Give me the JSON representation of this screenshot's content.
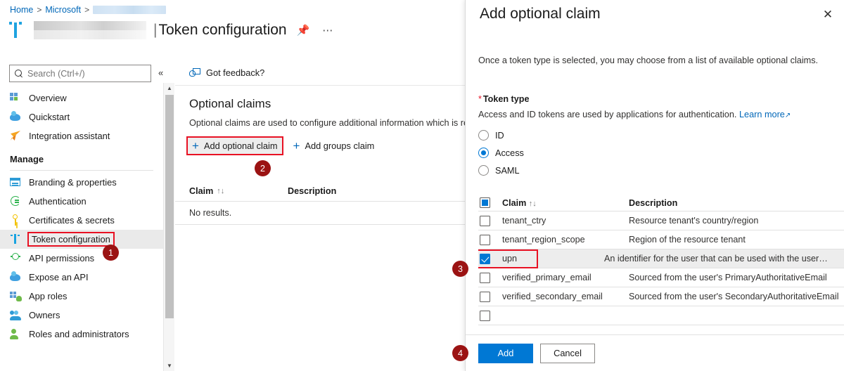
{
  "breadcrumb": {
    "home": "Home",
    "microsoft": "Microsoft",
    "sep": ">",
    "app_redacted": ""
  },
  "header": {
    "title_separator": "|",
    "title": "Token configuration",
    "pin_icon": "pin-icon",
    "more_icon": "ellipsis-icon"
  },
  "sidebar": {
    "search": {
      "placeholder": "Search (Ctrl+/)",
      "value": ""
    },
    "collapse_icon": "«",
    "items": [
      {
        "label": "Overview",
        "icon": "overview-grid-icon"
      },
      {
        "label": "Quickstart",
        "icon": "quickstart-cloud-icon"
      },
      {
        "label": "Integration assistant",
        "icon": "rocket-icon"
      }
    ],
    "section_manage": "Manage",
    "manage_items": [
      {
        "label": "Branding & properties",
        "icon": "branding-card-icon"
      },
      {
        "label": "Authentication",
        "icon": "authentication-icon"
      },
      {
        "label": "Certificates & secrets",
        "icon": "key-icon"
      },
      {
        "label": "Token configuration",
        "icon": "token-bars-icon",
        "selected": true
      },
      {
        "label": "API permissions",
        "icon": "api-permissions-icon"
      },
      {
        "label": "Expose an API",
        "icon": "expose-api-cloud-icon"
      },
      {
        "label": "App roles",
        "icon": "app-roles-icon"
      },
      {
        "label": "Owners",
        "icon": "owners-icon"
      },
      {
        "label": "Roles and administrators",
        "icon": "roles-admins-icon"
      }
    ]
  },
  "main": {
    "feedback": {
      "label": "Got feedback?",
      "icon": "feedback-person-icon"
    },
    "section_title": "Optional claims",
    "section_desc": "Optional claims are used to configure additional information which is re",
    "commands": [
      {
        "label": "Add optional claim",
        "icon": "plus-icon",
        "highlighted": true
      },
      {
        "label": "Add groups claim",
        "icon": "plus-icon",
        "highlighted": false
      }
    ],
    "table": {
      "columns": [
        "Claim",
        "Description"
      ],
      "sort_icon": "↑↓",
      "empty_text": "No results."
    }
  },
  "panel": {
    "title": "Add optional claim",
    "close_icon": "close-icon",
    "intro": "Once a token type is selected, you may choose from a list of available optional claims.",
    "token_type": {
      "label": "Token type",
      "required_marker": "*",
      "description": "Access and ID tokens are used by applications for authentication.",
      "learn_more": "Learn more",
      "external_icon": "↗",
      "options": [
        {
          "label": "ID",
          "selected": false
        },
        {
          "label": "Access",
          "selected": true
        },
        {
          "label": "SAML",
          "selected": false
        }
      ]
    },
    "claims_table": {
      "select_all_state": "indeterminate",
      "columns": [
        "Claim",
        "Description"
      ],
      "sort_icon": "↑↓",
      "rows": [
        {
          "name": "tenant_ctry",
          "description": "Resource tenant's country/region",
          "checked": false,
          "highlighted": false
        },
        {
          "name": "tenant_region_scope",
          "description": "Region of the resource tenant",
          "checked": false,
          "highlighted": false
        },
        {
          "name": "upn",
          "description": "An identifier for the user that can be used with the user…",
          "checked": true,
          "highlighted": true
        },
        {
          "name": "verified_primary_email",
          "description": "Sourced from the user's PrimaryAuthoritativeEmail",
          "checked": false,
          "highlighted": false
        },
        {
          "name": "verified_secondary_email",
          "description": "Sourced from the user's SecondaryAuthoritativeEmail",
          "checked": false,
          "highlighted": false
        },
        {
          "name": "",
          "description": "",
          "checked": false,
          "highlighted": false
        }
      ]
    },
    "footer": {
      "add_label": "Add",
      "cancel_label": "Cancel"
    }
  },
  "annotations": {
    "badge_color": "#9b1313",
    "highlight_color": "#e81123",
    "steps": [
      {
        "number": "1",
        "target": "sidebar-item-token-configuration"
      },
      {
        "number": "2",
        "target": "add-optional-claim-command"
      },
      {
        "number": "3",
        "target": "claim-row-upn"
      },
      {
        "number": "4",
        "target": "panel-add-button"
      }
    ]
  },
  "theme": {
    "accent": "#0078d4",
    "link": "#0067b8",
    "selected_row_bg": "#ededed"
  }
}
